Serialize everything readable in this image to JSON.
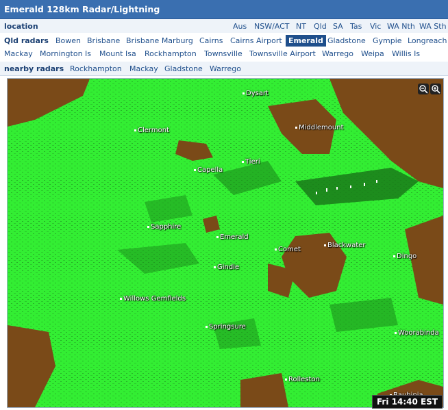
{
  "window": {
    "title": "Emerald 128km Radar/Lightning"
  },
  "location_row": {
    "label": "location",
    "items": [
      "Aus",
      "NSW/ACT",
      "NT",
      "Qld",
      "SA",
      "Tas",
      "Vic",
      "WA Nth",
      "WA Sth"
    ]
  },
  "qld_radars": {
    "label": "Qld radars",
    "items": [
      "Bowen",
      "Brisbane",
      "Brisbane Marburg",
      "Cairns",
      "Cairns Airport",
      "Emerald",
      "Gladstone",
      "Gympie",
      "Longreach"
    ],
    "items_line2": [
      "Mackay",
      "Mornington Is",
      "Mount Isa",
      "Rockhampton",
      "Townsville",
      "Townsville Airport",
      "Warrego",
      "Weipa",
      "Willis Is"
    ],
    "selected": "Emerald"
  },
  "nearby_radars": {
    "label": "nearby radars",
    "items": [
      "Rockhampton",
      "Mackay",
      "Gladstone",
      "Warrego"
    ]
  },
  "map": {
    "timestamp": "Fri 14:40 EST",
    "zoom_out_icon": "zoom-out-icon",
    "zoom_in_icon": "zoom-in-icon",
    "towns": [
      "Dysart",
      "Clermont",
      "Middlemount",
      "Capella",
      "Tieri",
      "Sapphire",
      "Emerald",
      "Comet",
      "Blackwater",
      "Dingo",
      "Gindie",
      "Willows Gemfields",
      "Springsure",
      "Woorabinda",
      "Rolleston",
      "Bauhinia"
    ],
    "colors": {
      "green": "#33ee33",
      "dark_green": "#1a8a1a",
      "brown": "#7a4a18",
      "title_bar": "#3a6fb0"
    }
  }
}
